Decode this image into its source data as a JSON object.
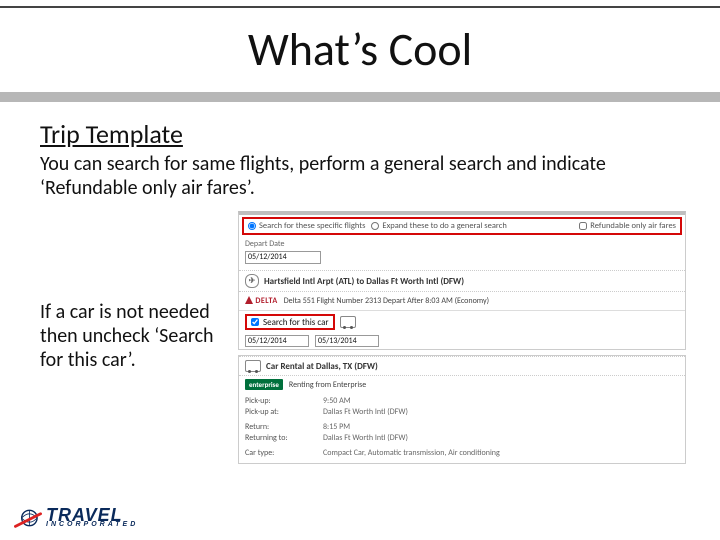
{
  "title": "What’s Cool",
  "subhead": "Trip Template",
  "body1": "You can search for same flights, perform a general search and indicate ‘Refundable only air fares’.",
  "body2": "If a car is not needed then uncheck ‘Search for this car’.",
  "opt_specific": "Search for these specific flights",
  "opt_general": "Expand these to do a general search",
  "opt_refundable": "Refundable only air fares",
  "depart_label": "Depart Date",
  "depart_date": "05/12/2014",
  "flight_seg": "Hartsfield Intl Arpt (ATL) to Dallas Ft Worth Intl (DFW)",
  "carrier_name": "DELTA",
  "carrier_line": "Delta 551 Flight Number 2313 Depart After 8:03 AM (Economy)",
  "search_car_label": "Search for this car",
  "car_date1": "05/12/2014",
  "car_date2": "05/13/2014",
  "car_seg": "Car Rental at Dallas, TX (DFW)",
  "vendor_name": "enterprise",
  "vendor_line": "Renting from Enterprise",
  "rows": {
    "pickup_k": "Pick-up:",
    "pickup_v": "9:50 AM",
    "pickup2_k": "Pick-up at:",
    "pickup2_v": "Dallas Ft Worth Intl (DFW)",
    "return_k": "Return:",
    "return_v": "8:15 PM",
    "return2_k": "Returning to:",
    "return2_v": "Dallas Ft Worth Intl (DFW)",
    "cartype_k": "Car type:",
    "cartype_v": "Compact Car, Automatic transmission, Air conditioning"
  },
  "logo_line1": "TRAVEL",
  "logo_line2": "INCORPORATED"
}
